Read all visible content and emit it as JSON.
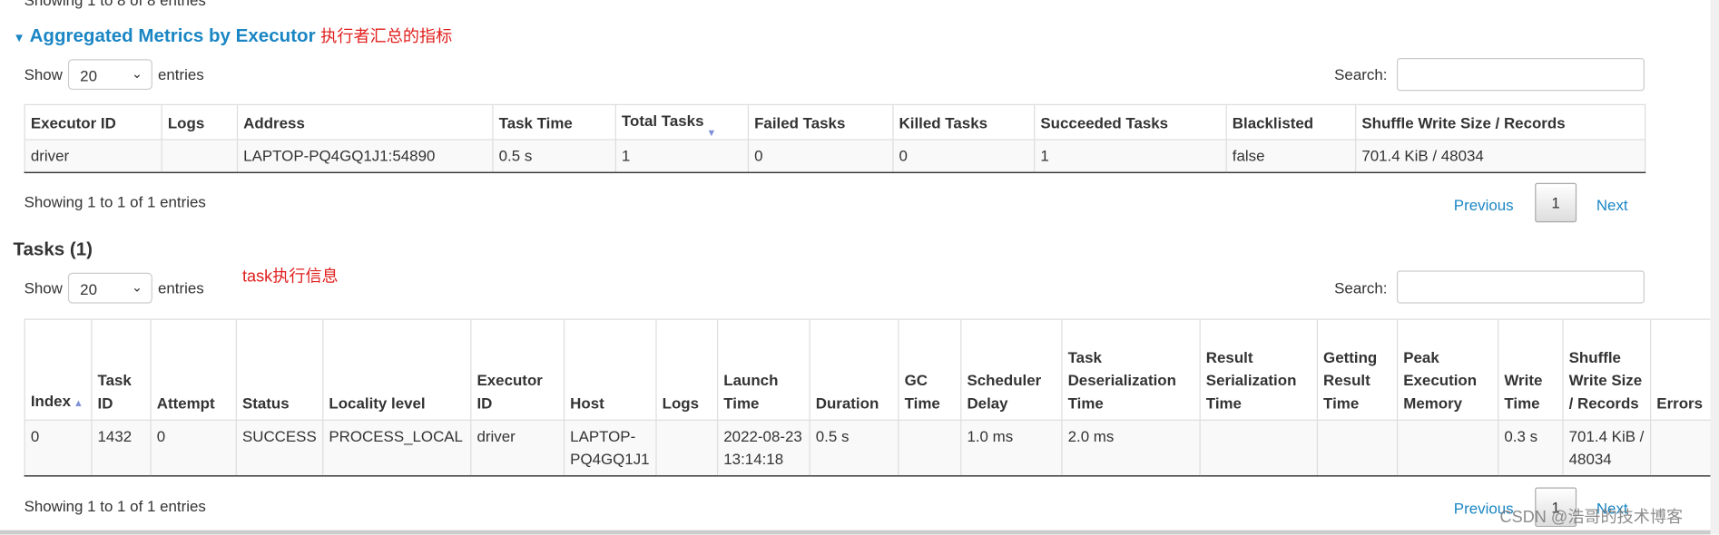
{
  "prev_info": "Showing 1 to 8 of 8 entries",
  "agg": {
    "title": "Aggregated Metrics by Executor",
    "annotation": "执行者汇总的指标",
    "show_label": "Show",
    "show_value": "20",
    "entries_label": "entries",
    "search_label": "Search:",
    "columns": [
      "Executor ID",
      "Logs",
      "Address",
      "Task Time",
      "Total Tasks",
      "Failed Tasks",
      "Killed Tasks",
      "Succeeded Tasks",
      "Blacklisted",
      "Shuffle Write Size / Records"
    ],
    "rows": [
      [
        "driver",
        "",
        "LAPTOP-PQ4GQ1J1:54890",
        "0.5 s",
        "1",
        "0",
        "0",
        "1",
        "false",
        "701.4 KiB / 48034"
      ]
    ],
    "info": "Showing 1 to 1 of 1 entries",
    "previous": "Previous",
    "page": "1",
    "next": "Next"
  },
  "tasks": {
    "title": "Tasks (1)",
    "annotation": "task执行信息",
    "show_label": "Show",
    "show_value": "20",
    "entries_label": "entries",
    "search_label": "Search:",
    "columns": [
      "Index",
      "Task ID",
      "Attempt",
      "Status",
      "Locality level",
      "Executor ID",
      "Host",
      "Logs",
      "Launch Time",
      "Duration",
      "GC Time",
      "Scheduler Delay",
      "Task Deserialization Time",
      "Result Serialization Time",
      "Getting Result Time",
      "Peak Execution Memory",
      "Write Time",
      "Shuffle Write Size / Records",
      "Errors"
    ],
    "rows": [
      [
        "0",
        "1432",
        "0",
        "SUCCESS",
        "PROCESS_LOCAL",
        "driver",
        "LAPTOP-PQ4GQ1J1",
        "",
        "2022-08-23 13:14:18",
        "0.5 s",
        "",
        "1.0 ms",
        "2.0 ms",
        "",
        "",
        "",
        "0.3 s",
        "701.4 KiB / 48034",
        ""
      ]
    ],
    "info": "Showing 1 to 1 of 1 entries",
    "previous": "Previous",
    "page": "1",
    "next": "Next"
  },
  "watermark": "CSDN @浩哥的技术博客",
  "colors": {
    "accent": "#1a86c4",
    "annotation": "#e0201e"
  }
}
